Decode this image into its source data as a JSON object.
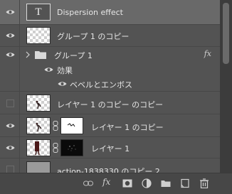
{
  "layers": {
    "text_layer": {
      "name": "Dispersion effect"
    },
    "group_copy": {
      "name": "グループ 1 のコピー"
    },
    "group": {
      "name": "グループ 1",
      "fx": "fx"
    },
    "effects": {
      "label": "効果"
    },
    "bevel": {
      "label": "ベベルとエンボス"
    },
    "layer_copy_copy": {
      "name": "レイヤー 1 のコピー のコピー"
    },
    "layer_copy": {
      "name": "レイヤー 1 のコピー"
    },
    "layer1": {
      "name": "レイヤー 1"
    },
    "action": {
      "name": "action-1838330 のコピー 2"
    }
  },
  "bottom_toolbar": {
    "fx_label": "fx"
  },
  "icons": {
    "eye": "eye-icon",
    "link": "link-icon",
    "folder": "folder-icon",
    "chevron": "chevron-right-icon",
    "mask": "add-mask-icon",
    "adjustment": "adjustment-layer-icon",
    "new_group": "new-group-icon",
    "new_layer": "new-layer-icon",
    "trash": "trash-icon"
  },
  "colors": {
    "panel_bg": "#535353",
    "selected_row": "#696969",
    "toolbar_bg": "#474747"
  }
}
